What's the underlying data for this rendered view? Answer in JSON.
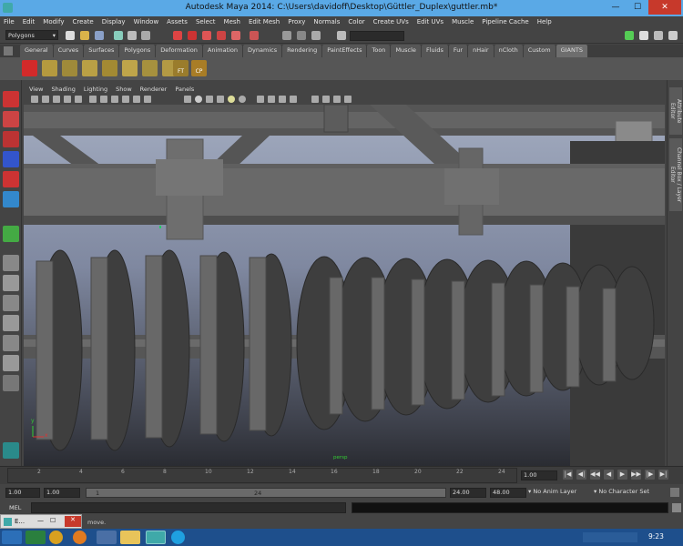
{
  "window": {
    "title": "Autodesk Maya 2014: C:\\Users\\davidoff\\Desktop\\Güttler_Duplex\\guttler.mb*",
    "minimize": "—",
    "maximize": "☐",
    "close": "✕"
  },
  "menubar": [
    "File",
    "Edit",
    "Modify",
    "Create",
    "Display",
    "Window",
    "Assets",
    "Select",
    "Mesh",
    "Edit Mesh",
    "Proxy",
    "Normals",
    "Color",
    "Create UVs",
    "Edit UVs",
    "Muscle",
    "Pipeline Cache",
    "Help"
  ],
  "statusline": {
    "mode_select": "Polygons"
  },
  "shelf_tabs": [
    "General",
    "Curves",
    "Surfaces",
    "Polygons",
    "Deformation",
    "Animation",
    "Dynamics",
    "Rendering",
    "PaintEffects",
    "Toon",
    "Muscle",
    "Fluids",
    "Fur",
    "nHair",
    "nCloth",
    "Custom",
    "GIANTS"
  ],
  "shelf_active_tab": "GIANTS",
  "shelf_icon_labels": {
    "ft": "FT",
    "cp": "CP"
  },
  "panel_menu": [
    "View",
    "Shading",
    "Lighting",
    "Show",
    "Renderer",
    "Panels"
  ],
  "right_tabs": [
    "Attribute Editor",
    "Channel Box / Layer Editor"
  ],
  "viewport": {
    "camera_label": "persp",
    "axis": {
      "x": "x",
      "y": "y"
    }
  },
  "timeline": {
    "ticks": [
      "2",
      "4",
      "6",
      "8",
      "10",
      "12",
      "14",
      "16",
      "18",
      "20",
      "22",
      "24"
    ],
    "current_frame": "1.00"
  },
  "playback_buttons": [
    "|◀",
    "◀|",
    "◀◀",
    "◀",
    "▶",
    "▶▶",
    "|▶",
    "▶|"
  ],
  "range": {
    "start_time": "1.00",
    "playback_start": "1.00",
    "slider_start": "1",
    "slider_end": "24",
    "playback_end": "24.00",
    "end_time": "48.00",
    "anim_layer": "No Anim Layer",
    "character_set": "No Character Set"
  },
  "cmdline": {
    "label": "MEL"
  },
  "helpline": {
    "text": "move.",
    "floating_panel_title": "E..."
  },
  "taskbar": {
    "clock": "9:23"
  }
}
